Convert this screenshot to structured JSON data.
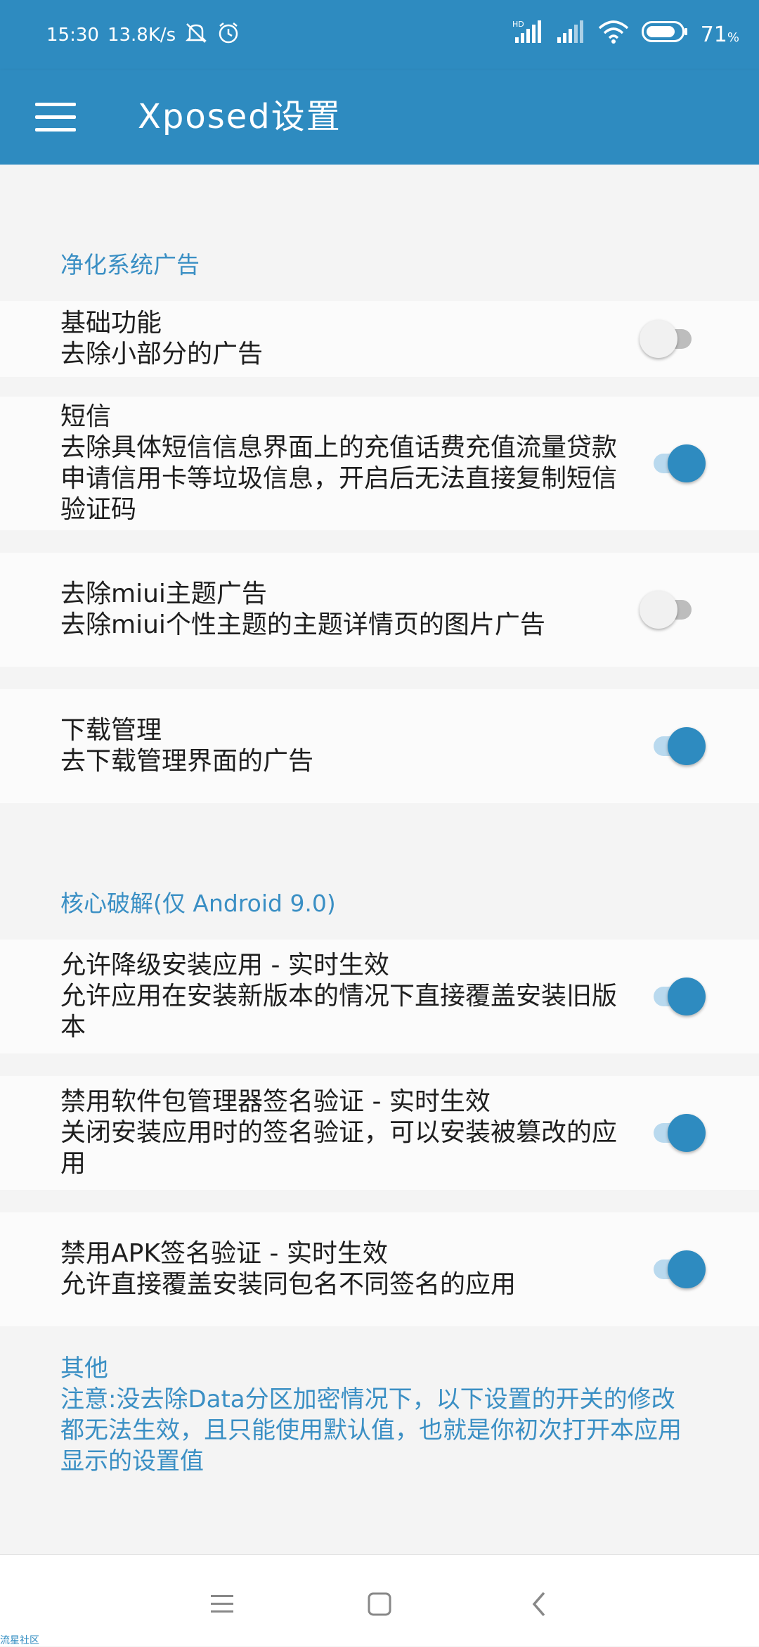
{
  "status_bar": {
    "time": "15:30",
    "net_speed": "13.8K/s",
    "battery": "71",
    "battery_unit": "%",
    "icons": [
      "mute-icon",
      "alarm-icon",
      "hd-signal-icon",
      "signal-icon",
      "wifi-icon",
      "battery-icon"
    ]
  },
  "app_bar": {
    "title": "Xposed设置"
  },
  "sections": [
    {
      "header": "净化系统广告",
      "items": [
        {
          "title": "基础功能",
          "summary": "去除小部分的广告",
          "checked": false
        },
        {
          "title": "短信",
          "summary": "去除具体短信信息界面上的充值话费充值流量贷款申请信用卡等垃圾信息，开启后无法直接复制短信验证码",
          "checked": true
        },
        {
          "title": "去除miui主题广告",
          "summary": "去除miui个性主题的主题详情页的图片广告",
          "checked": false
        },
        {
          "title": "下载管理",
          "summary": "去下载管理界面的广告",
          "checked": true
        }
      ]
    },
    {
      "header": "核心破解(仅 Android 9.0)",
      "items": [
        {
          "title": "允许降级安装应用 - 实时生效",
          "summary": "允许应用在安装新版本的情况下直接覆盖安装旧版本",
          "checked": true
        },
        {
          "title": "禁用软件包管理器签名验证 - 实时生效",
          "summary": "关闭安装应用时的签名验证，可以安装被篡改的应用",
          "checked": true
        },
        {
          "title": "禁用APK签名验证 - 实时生效",
          "summary": "允许直接覆盖安装同包名不同签名的应用",
          "checked": true
        }
      ]
    },
    {
      "header": "其他",
      "note": "注意:没去除Data分区加密情况下，以下设置的开关的修改都无法生效，且只能使用默认值，也就是你初次打开本应用显示的设置值"
    }
  ],
  "watermark": "流星社区",
  "colors": {
    "primary": "#2e8bc0",
    "track_on": "#b9d9ee",
    "track_off": "#bdbdbd",
    "background": "#f4f4f4"
  }
}
